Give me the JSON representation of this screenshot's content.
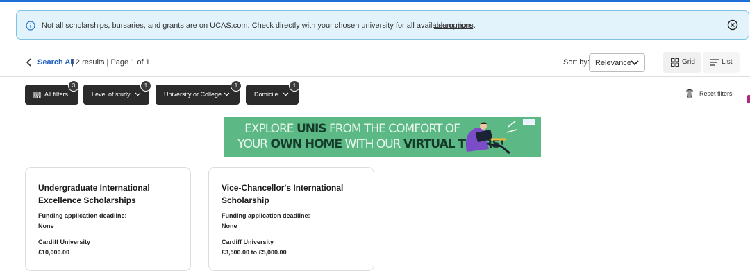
{
  "notice": {
    "text": "Not all scholarships, bursaries, and grants are on UCAS.com. Check directly with your chosen university for all available options.",
    "link": "Learn more"
  },
  "results": {
    "search_all": "Search All",
    "summary": "| 2 results | Page 1 of 1",
    "sort_label": "Sort by:",
    "sort_value": "Relevance",
    "grid_label": "Grid",
    "list_label": "List"
  },
  "filters": [
    {
      "label": "All filters",
      "count": "3"
    },
    {
      "label": "Level of study",
      "count": "1"
    },
    {
      "label": "University or College",
      "count": "1"
    },
    {
      "label": "Domicile",
      "count": "1"
    }
  ],
  "reset_label": "Reset filters",
  "ad": {
    "line1_a": "EXPLORE ",
    "line1_b": "UNIS",
    "line1_c": " FROM THE COMFORT OF",
    "line2_a": "YOUR ",
    "line2_b": "OWN HOME",
    "line2_c": " WITH OUR ",
    "line2_d": "VIRTUAL TOURS!",
    "colors": {
      "background": "#5cb985",
      "accent": "#163a2a"
    }
  },
  "cards": [
    {
      "title": "Undergraduate International Excellence Scholarships",
      "deadline_label": "Funding application deadline:",
      "deadline": "None",
      "university": "Cardiff University",
      "amount": "£10,000.00"
    },
    {
      "title": "Vice-Chancellor's International Scholarship",
      "deadline_label": "Funding application deadline:",
      "deadline": "None",
      "university": "Cardiff University",
      "amount": "£3,500.00 to £5,000.00"
    }
  ],
  "icons": [
    "info-icon",
    "close-icon",
    "chevron-left-icon",
    "chevron-down-icon",
    "grid-icon",
    "list-icon",
    "sliders-icon",
    "trash-icon"
  ]
}
